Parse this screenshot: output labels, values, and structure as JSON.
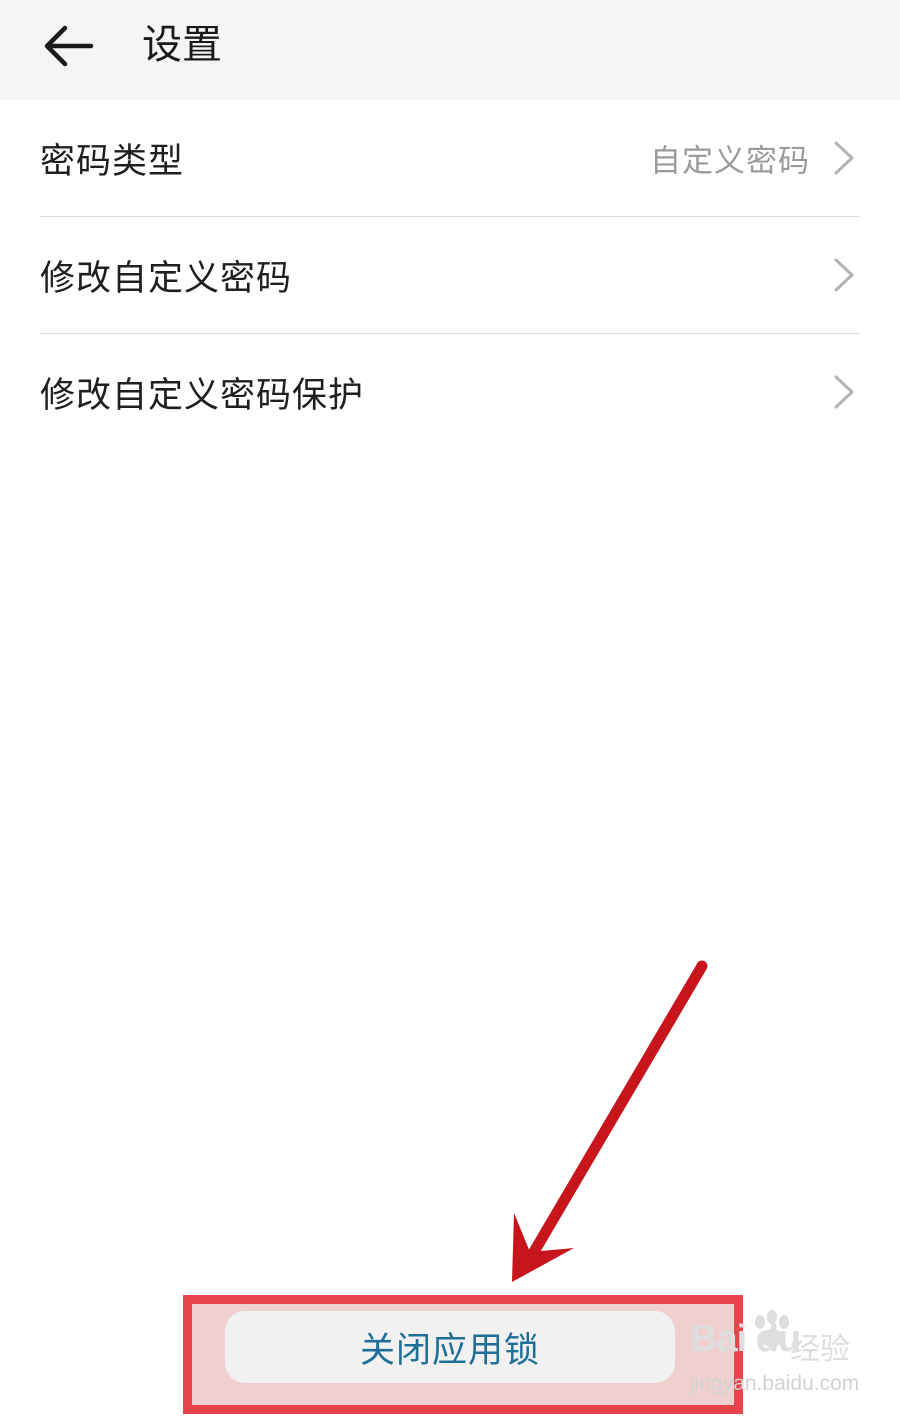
{
  "header": {
    "title": "设置"
  },
  "settings_list": [
    {
      "label": "密码类型",
      "value": "自定义密码"
    },
    {
      "label": "修改自定义密码",
      "value": ""
    },
    {
      "label": "修改自定义密码保护",
      "value": ""
    }
  ],
  "footer": {
    "close_button_label": "关闭应用锁"
  },
  "watermark": {
    "brand": "Bai du",
    "tag": "经验",
    "url": "jingyan.baidu.com"
  },
  "colors": {
    "header_bg": "#f5f5f5",
    "accent_text": "#1f6f99",
    "annotation_red": "#c8151c",
    "highlight_border": "#e8424a"
  }
}
